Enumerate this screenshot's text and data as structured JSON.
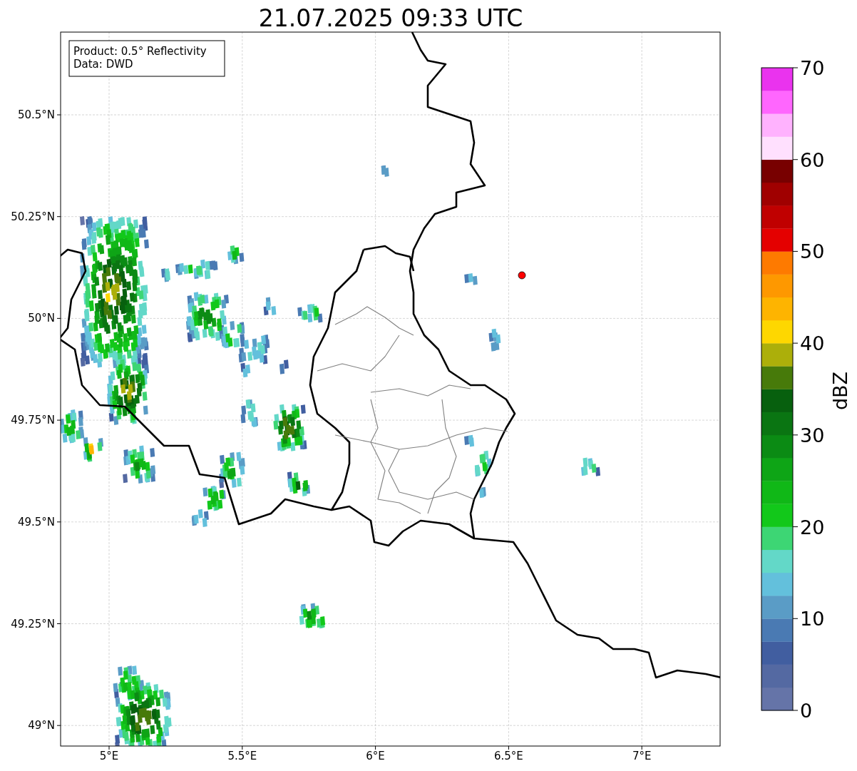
{
  "title": "21.07.2025 09:33 UTC",
  "info_box": [
    "Product: 0.5° Reflectivity",
    "Data: DWD"
  ],
  "y_ticks": [
    "50.5°N",
    "50.25°N",
    "50°N",
    "49.75°N",
    "49.5°N",
    "49.25°N",
    "49°N"
  ],
  "x_ticks": [
    "5°E",
    "5.5°E",
    "6°E",
    "6.5°E",
    "7°E"
  ],
  "colorbar": {
    "label": "dBZ",
    "ticks": [
      "70",
      "60",
      "50",
      "40",
      "30",
      "20",
      "10",
      "0"
    ],
    "segments": [
      {
        "color": "#6574a8"
      },
      {
        "color": "#5469a2"
      },
      {
        "color": "#415ea0"
      },
      {
        "color": "#4a7ab3"
      },
      {
        "color": "#5a9cc6"
      },
      {
        "color": "#63c0dc"
      },
      {
        "color": "#63d8c8"
      },
      {
        "color": "#3dd674"
      },
      {
        "color": "#12c81a"
      },
      {
        "color": "#10b817"
      },
      {
        "color": "#0ea516"
      },
      {
        "color": "#0b8b14"
      },
      {
        "color": "#0a7512"
      },
      {
        "color": "#07600e"
      },
      {
        "color": "#477a0a"
      },
      {
        "color": "#acaf0a"
      },
      {
        "color": "#fed700"
      },
      {
        "color": "#feb400"
      },
      {
        "color": "#fe9800"
      },
      {
        "color": "#fe7a00"
      },
      {
        "color": "#e40000"
      },
      {
        "color": "#c00000"
      },
      {
        "color": "#a00000"
      },
      {
        "color": "#780000"
      },
      {
        "color": "#ffe0fe"
      },
      {
        "color": "#ffb2fe"
      },
      {
        "color": "#ff66fe"
      },
      {
        "color": "#ea33ee"
      }
    ]
  }
}
